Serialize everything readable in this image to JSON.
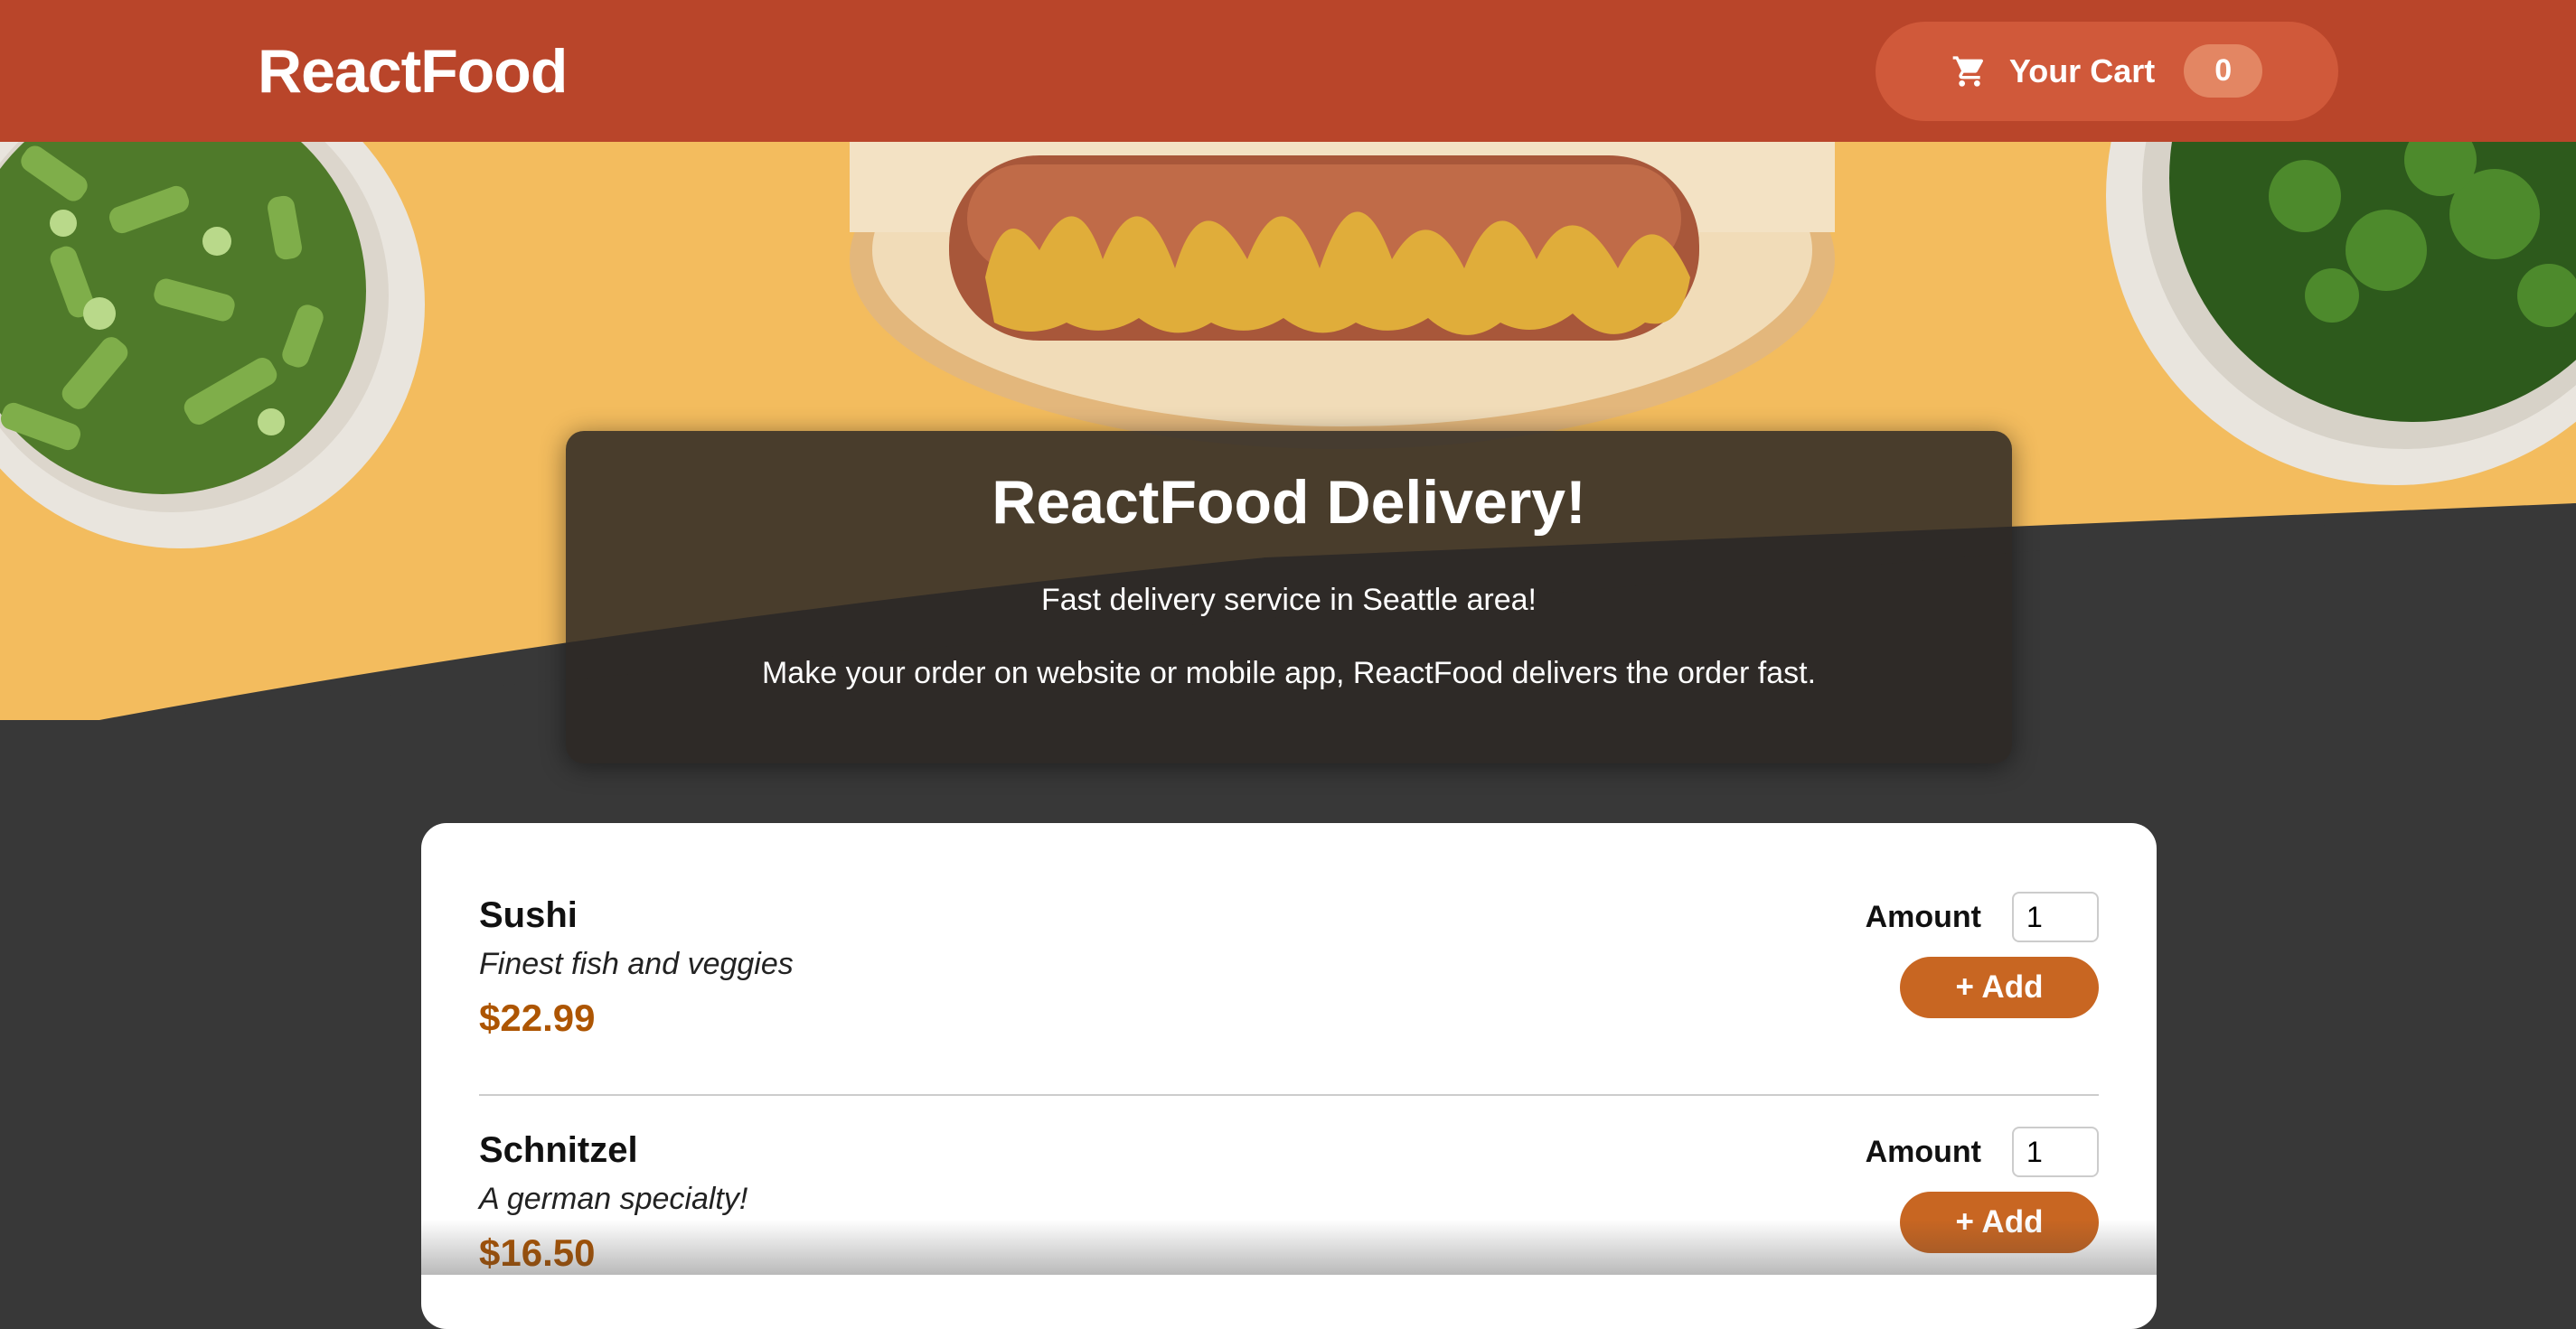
{
  "header": {
    "logo": "ReactFood",
    "cart_label": "Your Cart",
    "cart_count": "0"
  },
  "summary": {
    "title": "ReactFood Delivery!",
    "line1": "Fast delivery service in Seattle area!",
    "line2": "Make your order on website or mobile app, ReactFood delivers the order fast."
  },
  "meals": [
    {
      "name": "Sushi",
      "description": "Finest fish and veggies",
      "price": "$22.99",
      "amount_label": "Amount",
      "amount_value": "1",
      "add_label": "+ Add"
    },
    {
      "name": "Schnitzel",
      "description": "A german specialty!",
      "price": "$16.50",
      "amount_label": "Amount",
      "amount_value": "1",
      "add_label": "+ Add"
    }
  ],
  "colors": {
    "header_bg": "#b9452a",
    "cart_button_bg": "#d0593a",
    "badge_bg": "#e38663",
    "page_bg": "#383838",
    "hero_bg": "#f2b95a",
    "price": "#ad5502",
    "add_button": "#c86622"
  },
  "icons": {
    "cart": "cart-icon"
  }
}
